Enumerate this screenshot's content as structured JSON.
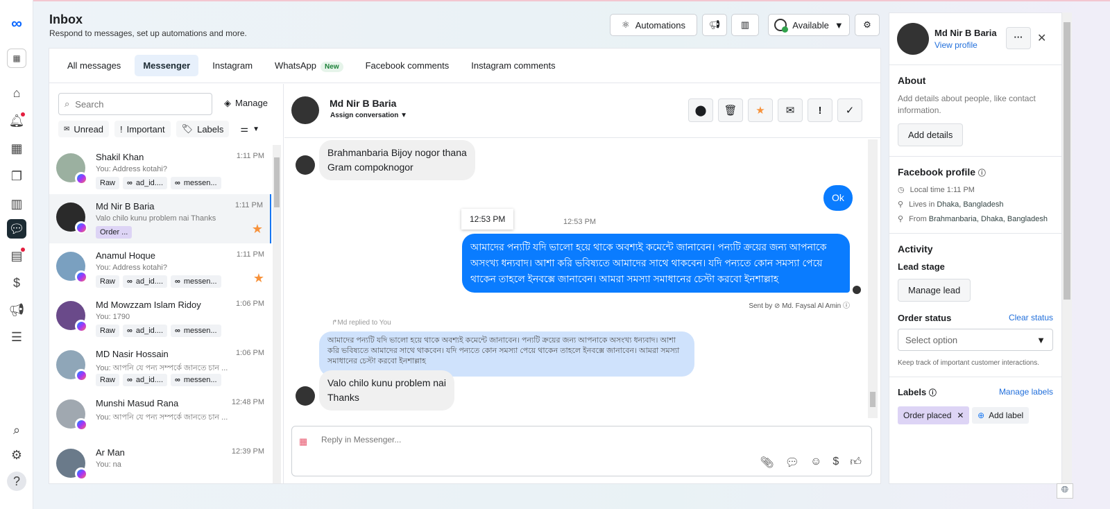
{
  "header": {
    "title": "Inbox",
    "subtitle": "Respond to messages, set up automations and more.",
    "automations": "Automations",
    "status": "Available"
  },
  "rail": {
    "icons": [
      "meta-logo",
      "pages-icon",
      "home-icon",
      "notifications-icon",
      "calendar-icon",
      "content-icon",
      "insights-icon",
      "inbox-icon",
      "contacts-icon",
      "monetization-icon",
      "ads-icon",
      "menu-icon",
      "search-icon",
      "settings-icon",
      "help-icon"
    ]
  },
  "tabs": [
    {
      "label": "All messages"
    },
    {
      "label": "Messenger",
      "selected": true
    },
    {
      "label": "Instagram"
    },
    {
      "label": "WhatsApp",
      "badge": "New"
    },
    {
      "label": "Facebook comments"
    },
    {
      "label": "Instagram comments"
    }
  ],
  "list": {
    "search_placeholder": "Search",
    "manage": "Manage",
    "filters": {
      "unread": "Unread",
      "important": "Important",
      "labels": "Labels"
    },
    "conversations": [
      {
        "name": "Shakil Khan",
        "preview": "You: Address kotahi?",
        "time": "1:11 PM",
        "tags": [
          "Raw",
          "ad_id....",
          "messen..."
        ]
      },
      {
        "name": "Md Nir B Baria",
        "preview": "Valo chilo kunu problem nai Thanks",
        "time": "1:11 PM",
        "tags": [
          "Order ..."
        ],
        "starred": true,
        "selected": true
      },
      {
        "name": "Anamul Hoque",
        "preview": "You: Address kotahi?",
        "time": "1:11 PM",
        "tags": [
          "Raw",
          "ad_id....",
          "messen..."
        ],
        "starred": true
      },
      {
        "name": "Md Mowzzam Islam Ridoy",
        "preview": "You: 1790",
        "time": "1:06 PM",
        "tags": [
          "Raw",
          "ad_id....",
          "messen..."
        ]
      },
      {
        "name": "MD Nasir Hossain",
        "preview": "You: আপনি যে পন্য সম্পর্কে জানতে চান ...",
        "time": "1:06 PM",
        "tags": [
          "Raw",
          "ad_id....",
          "messen..."
        ]
      },
      {
        "name": "Munshi Masud Rana",
        "preview": "You: আপনি যে পন্য সম্পর্কে জানতে চান ...",
        "time": "12:48 PM",
        "tags": []
      },
      {
        "name": "Ar Man",
        "preview": "You: na",
        "time": "12:39 PM",
        "tags": []
      }
    ]
  },
  "chat": {
    "name": "Md Nir B Baria",
    "assign": "Assign conversation",
    "messages": {
      "m1": "Brahmanbaria Bijoy nogor thana\nGram compoknogor",
      "m2": "Ok",
      "tooltip": "12:53 PM",
      "time": "12:53 PM",
      "m3": "আমাদের পন্যটি যদি ভালো হয়ে থাকে অবশ্যই কমেন্টে জানাবেন। পন্যটি ক্রয়ের জন্য আপনাকে অসংখ্য ধন্যবাদ। আশা করি ভবিষ্যতে আমাদের সাথে থাকবেন। যদি পন্যতে কোন সমস্যা পেয়ে থাকেন তাহলে ইনবক্সে জানাবেন। আমরা সমস্যা সমাধানের চেস্টা করবো ইনশাল্লাহ",
      "sent_by": "Sent by",
      "sender": "Md. Faysal Al Amin",
      "replied": "Md replied to You",
      "quoted": "আমাদের পন্যটি যদি ভালো হয়ে থাকে অবশ্যই কমেন্টে জানাবেন। পন্যটি ক্রয়ের জন্য আপনাকে অসংখ্য ধন্যবাদ। আশা করি ভবিষ্যতে আমাদের সাথে থাকবেন। যদি পন্যতে কোন সমস্যা পেয়ে থাকেন তাহলে ইনবক্সে জানাবেন। আমরা সমস্যা সমাধানের চেস্টা করবো ইনশাল্লাহ",
      "m4": "Valo chilo kunu problem nai\nThanks"
    },
    "reply_placeholder": "Reply in Messenger..."
  },
  "side": {
    "name": "Md Nir B Baria",
    "view_profile": "View profile",
    "about_title": "About",
    "about_text": "Add details about people, like contact information.",
    "add_details": "Add details",
    "fb_title": "Facebook profile",
    "local_time": "Local time 1:11 PM",
    "lives_pre": "Lives in",
    "lives": "Dhaka, Bangladesh",
    "from_pre": "From",
    "from": "Brahmanbaria, Dhaka, Bangladesh",
    "activity": "Activity",
    "lead_stage": "Lead stage",
    "manage_lead": "Manage lead",
    "order_status": "Order status",
    "clear_status": "Clear status",
    "select_option": "Select option",
    "order_hint": "Keep track of important customer interactions.",
    "labels": "Labels",
    "manage_labels": "Manage labels",
    "label": "Order placed",
    "add_label": "Add label"
  },
  "colors": {
    "accent": "#1877f2",
    "outgoing": "#0a7cff",
    "star": "#f7923b",
    "quoted": "#cfe2fc"
  }
}
